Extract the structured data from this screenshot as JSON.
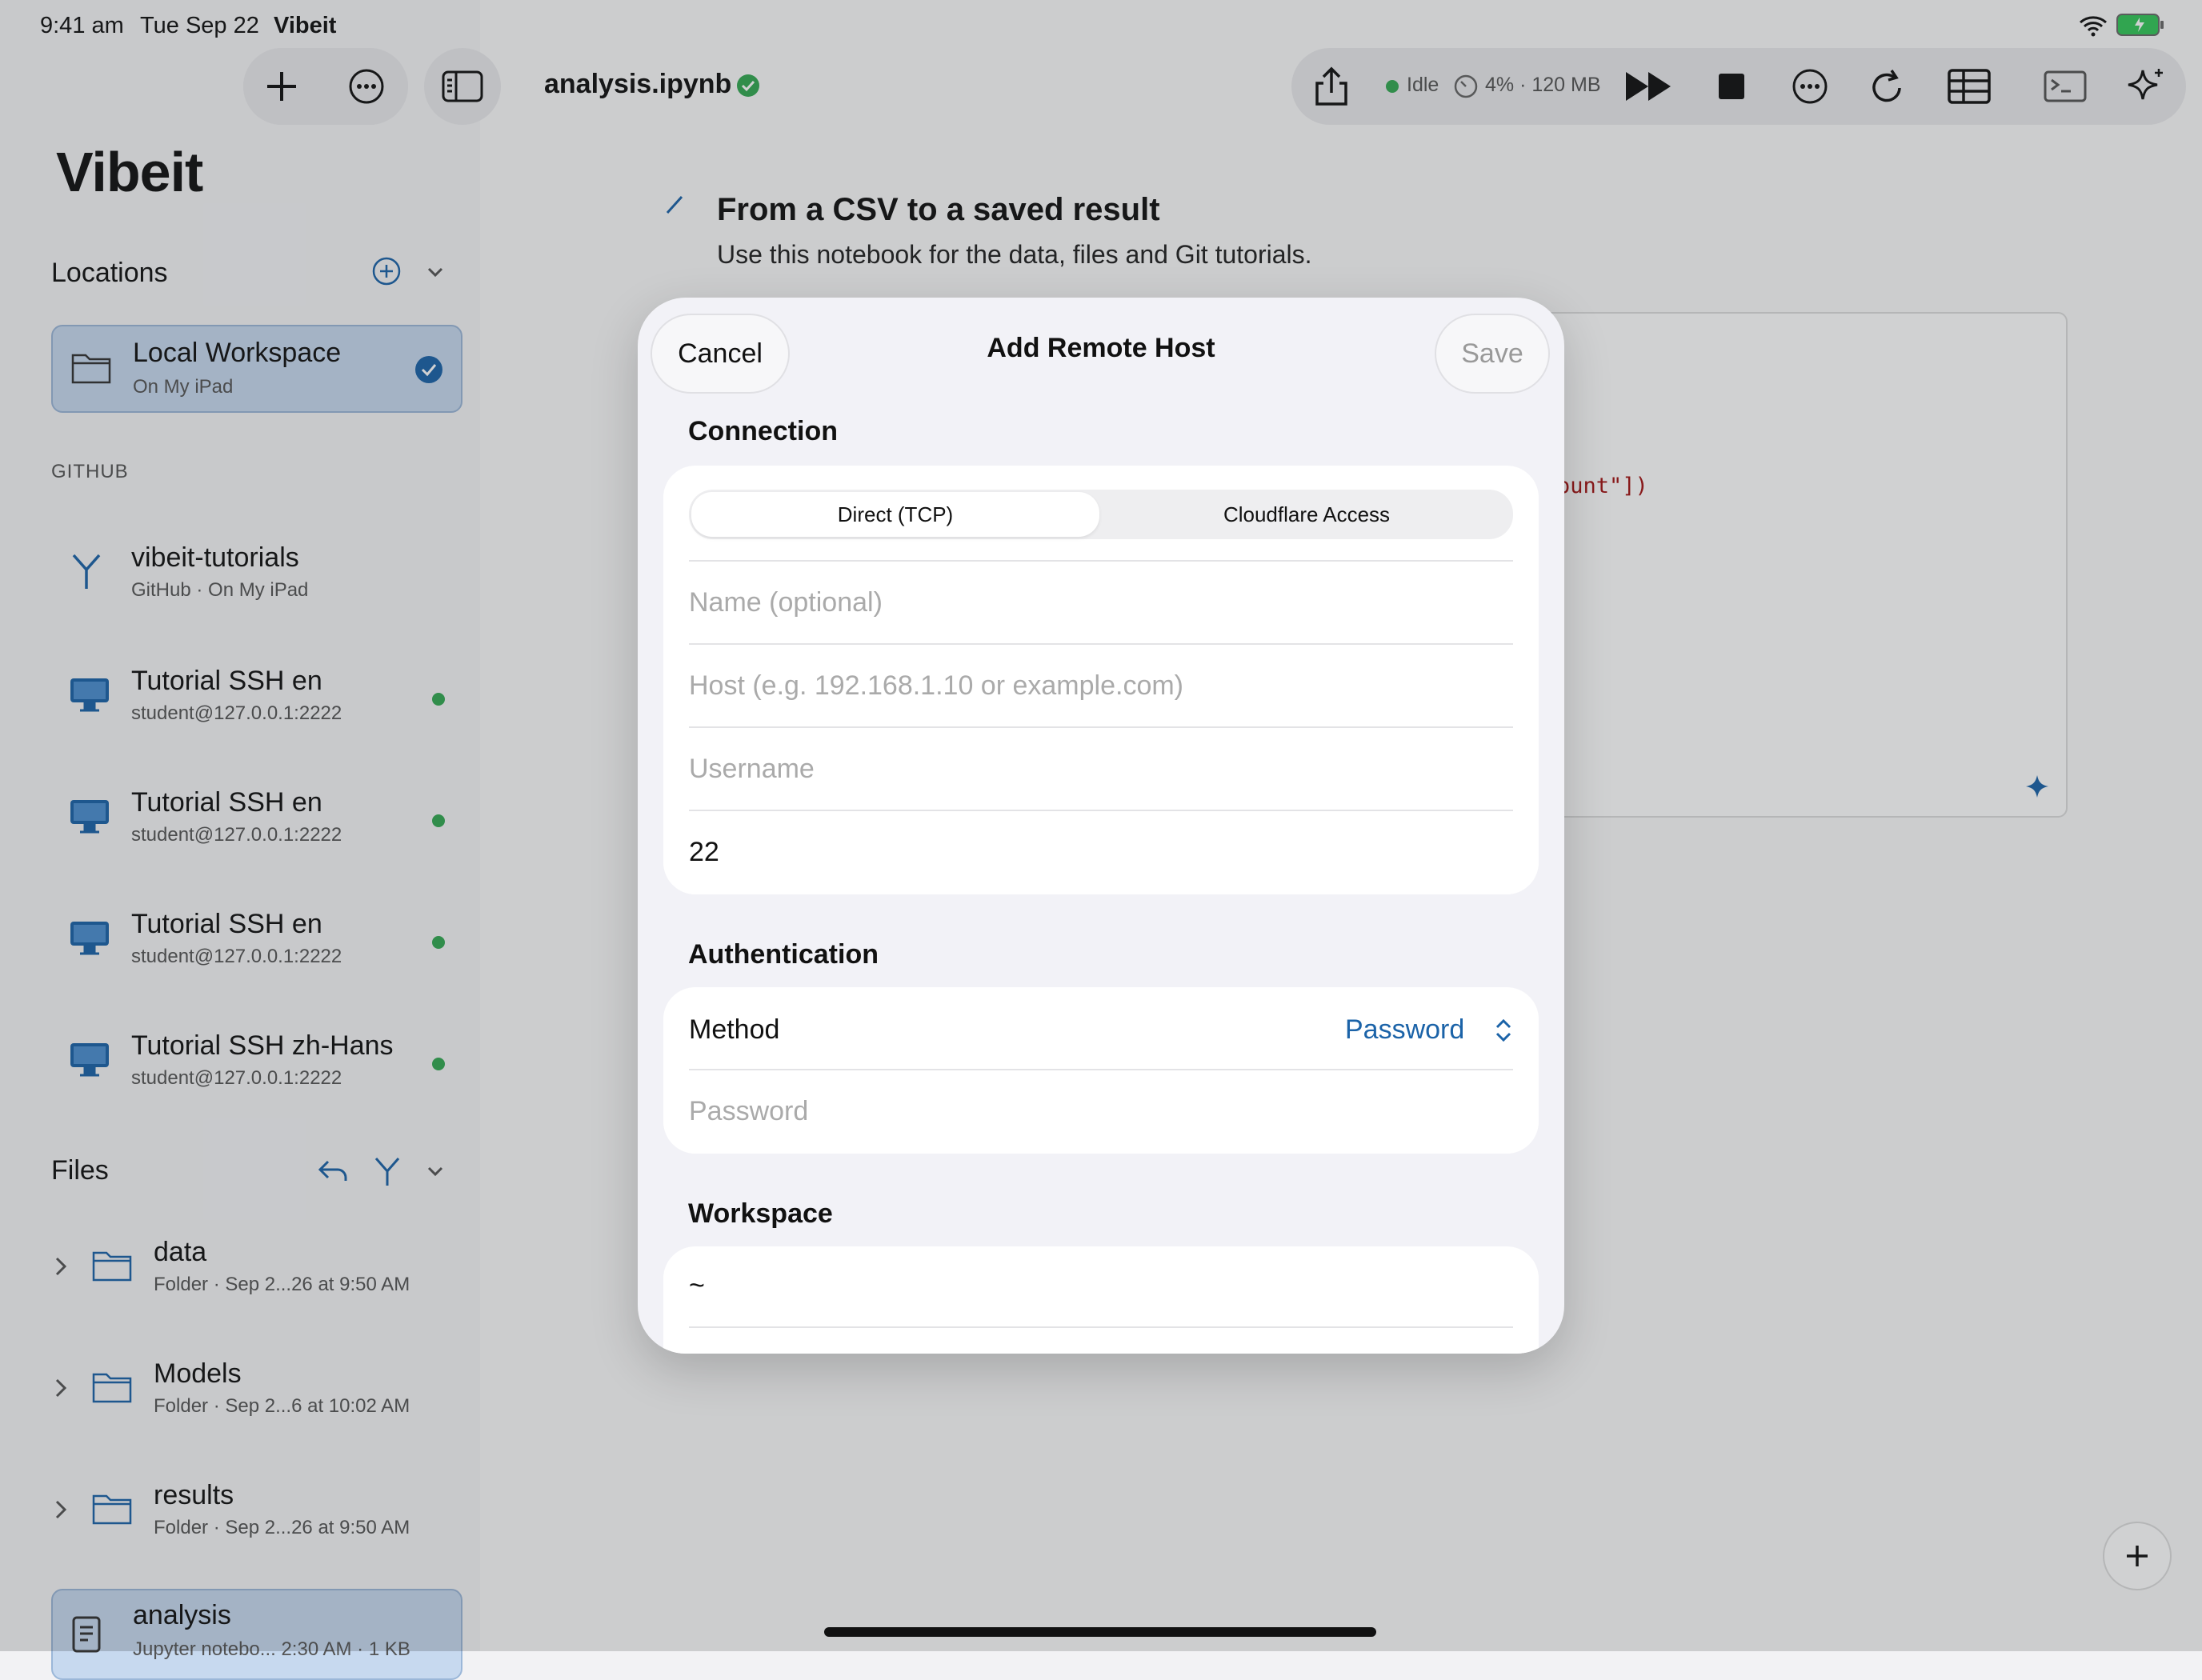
{
  "status_bar": {
    "time": "9:41 am",
    "date": "Tue Sep 22",
    "app": "Vibeit"
  },
  "sidebar": {
    "brand": "Vibeit",
    "locations_header": "Locations",
    "local": {
      "title": "Local Workspace",
      "subtitle": "On My iPad"
    },
    "github_header": "GITHUB",
    "remotes": [
      {
        "title": "vibeit-tutorials",
        "subtitle": "GitHub · On My iPad",
        "icon": "branch-icon"
      },
      {
        "title": "Tutorial SSH en",
        "subtitle": "student@127.0.0.1:2222",
        "icon": "computer-icon",
        "online": true
      },
      {
        "title": "Tutorial SSH en",
        "subtitle": "student@127.0.0.1:2222",
        "icon": "computer-icon",
        "online": true
      },
      {
        "title": "Tutorial SSH en",
        "subtitle": "student@127.0.0.1:2222",
        "icon": "computer-icon",
        "online": true
      },
      {
        "title": "Tutorial SSH zh-Hans",
        "subtitle": "student@127.0.0.1:2222",
        "icon": "computer-icon",
        "online": true
      }
    ],
    "files_header": "Files",
    "files": [
      {
        "name": "data",
        "meta": "Folder · Sep 2...26 at 9:50 AM"
      },
      {
        "name": "Models",
        "meta": "Folder · Sep 2...6 at 10:02 AM"
      },
      {
        "name": "results",
        "meta": "Folder · Sep 2...26 at 9:50 AM"
      }
    ],
    "current_file": {
      "name": "analysis",
      "meta": "Jupyter notebo... 2:30 AM · 1 KB"
    }
  },
  "toolbar": {
    "notebook_title": "analysis.ipynb",
    "kernel_status": "Idle",
    "resources": "4% · 120 MB"
  },
  "notebook": {
    "md_title": "From a CSV to a saved result",
    "md_subtitle": "Use this notebook for the data, files and Git tutorials.",
    "code_fragment": "ount\"])"
  },
  "modal": {
    "title": "Add Remote Host",
    "cancel_label": "Cancel",
    "save_label": "Save",
    "connection_header": "Connection",
    "segments": [
      "Direct (TCP)",
      "Cloudflare Access"
    ],
    "selected_segment": "Direct (TCP)",
    "name_placeholder": "Name (optional)",
    "host_placeholder": "Host (e.g. 192.168.1.10 or example.com)",
    "username_placeholder": "Username",
    "port_value": "22",
    "auth_header": "Authentication",
    "method_label": "Method",
    "method_value": "Password",
    "password_placeholder": "Password",
    "workspace_header": "Workspace",
    "workspace_value": "~"
  },
  "colors": {
    "accent": "#1b63a8",
    "online": "#34a853",
    "selected_bg": "#c7d9ef"
  }
}
